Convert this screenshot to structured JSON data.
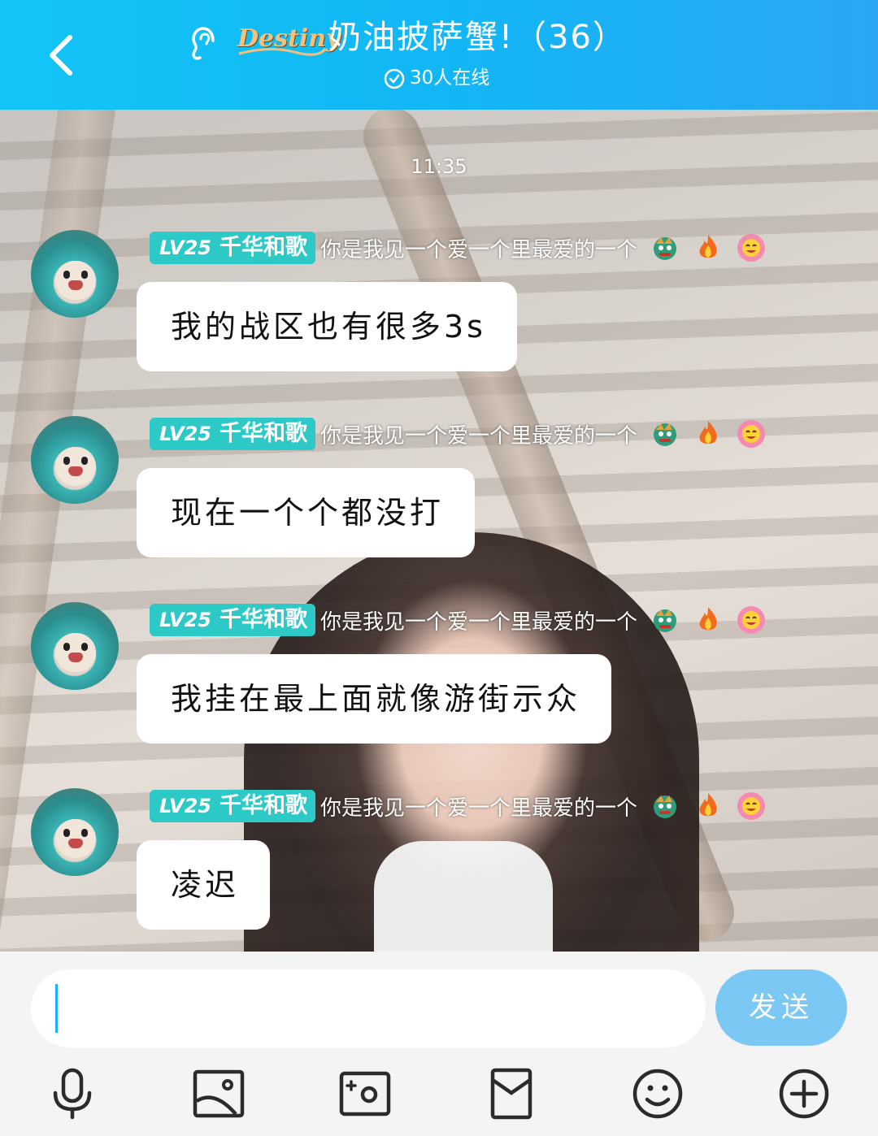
{
  "header": {
    "title": "奶油披萨蟹!（36）",
    "logo_text": "Destiny",
    "online_status": "30人在线",
    "background_color": "#12b7f5",
    "icons": [
      "back-arrow-icon",
      "ear-icon",
      "check-circle-icon"
    ]
  },
  "chat": {
    "timestamp": "11:35",
    "messages": [
      {
        "level": "LV25",
        "nickname": "千华和歌",
        "signature": "你是我见一个爱一个里最爱的一个",
        "text": "我的战区也有很多3s"
      },
      {
        "level": "LV25",
        "nickname": "千华和歌",
        "signature": "你是我见一个爱一个里最爱的一个",
        "text": "现在一个个都没打"
      },
      {
        "level": "LV25",
        "nickname": "千华和歌",
        "signature": "你是我见一个爱一个里最爱的一个",
        "text": "我挂在最上面就像游街示众"
      },
      {
        "level": "LV25",
        "nickname": "千华和歌",
        "signature": "你是我见一个爱一个里最爱的一个",
        "text": "凌迟"
      }
    ],
    "badge_icons": [
      "dragon-icon",
      "fire-icon",
      "flower-face-icon"
    ],
    "level_tag_color": "#2dc9c6"
  },
  "input": {
    "value": "",
    "send_label": "发送",
    "send_color": "#7cc8f5",
    "toolbar_icons": [
      "microphone-icon",
      "image-icon",
      "camera-icon",
      "red-packet-icon",
      "emoji-icon",
      "plus-icon"
    ]
  }
}
